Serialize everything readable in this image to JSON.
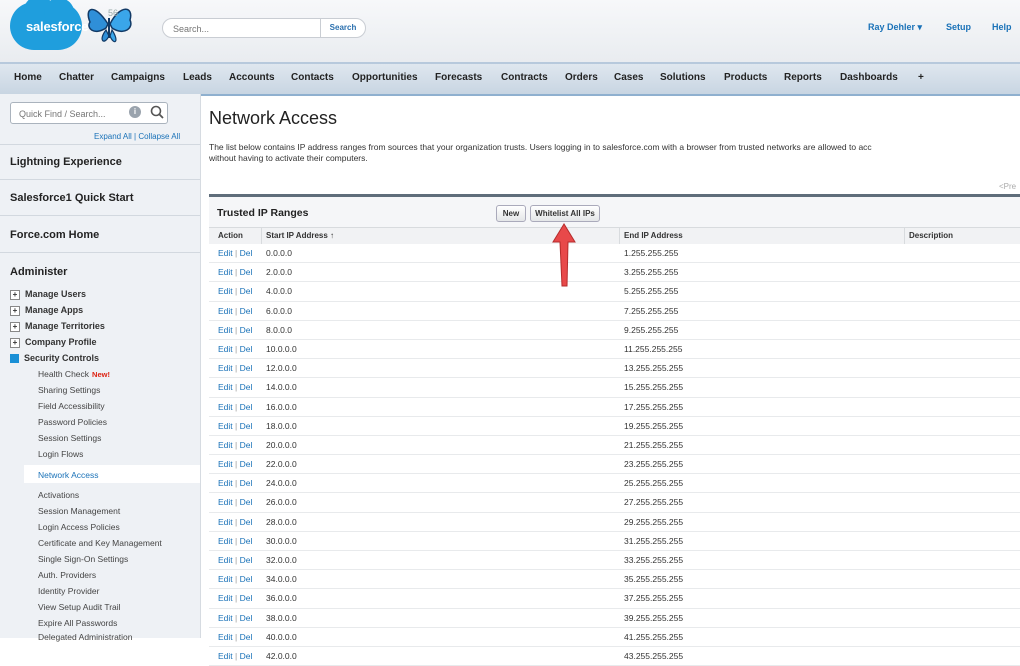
{
  "header": {
    "logo_text": "salesforce",
    "version_badge": "56",
    "search_placeholder": "Search...",
    "search_button": "Search",
    "user_name": "Ray Dehler",
    "setup_label": "Setup",
    "help_label": "Help"
  },
  "nav": {
    "tabs": [
      "Home",
      "Chatter",
      "Campaigns",
      "Leads",
      "Accounts",
      "Contacts",
      "Opportunities",
      "Forecasts",
      "Contracts",
      "Orders",
      "Cases",
      "Solutions",
      "Products",
      "Reports",
      "Dashboards",
      "+"
    ]
  },
  "sidebar": {
    "quick_find_placeholder": "Quick Find / Search...",
    "expand_all": "Expand All",
    "collapse_all": "Collapse All",
    "sections": [
      "Lightning Experience",
      "Salesforce1 Quick Start",
      "Force.com Home",
      "Administer"
    ],
    "groups": [
      "Manage Users",
      "Manage Apps",
      "Manage Territories",
      "Company Profile",
      "Security Controls"
    ],
    "security_items": [
      "Health Check",
      "Sharing Settings",
      "Field Accessibility",
      "Password Policies",
      "Session Settings",
      "Login Flows",
      "Network Access",
      "Activations",
      "Session Management",
      "Login Access Policies",
      "Certificate and Key Management",
      "Single Sign-On Settings",
      "Auth. Providers",
      "Identity Provider",
      "View Setup Audit Trail",
      "Expire All Passwords",
      "Delegated Administration"
    ],
    "new_badge": "New!"
  },
  "main": {
    "title": "Network Access",
    "description_line1": "The list below contains IP address ranges from sources that your organization trusts. Users logging in to salesforce.com with a browser from trusted networks are allowed to acc",
    "description_line2": "without having to activate their computers.",
    "prev_link": "<Pre",
    "panel_title": "Trusted IP Ranges",
    "new_button": "New",
    "whitelist_button": "Whitelist All IPs",
    "columns": {
      "action": "Action",
      "start": "Start IP Address",
      "sort_indicator": "↑",
      "end": "End IP Address",
      "description": "Description"
    },
    "edit_label": "Edit",
    "del_label": "Del",
    "rows": [
      {
        "start": "0.0.0.0",
        "end": "1.255.255.255"
      },
      {
        "start": "2.0.0.0",
        "end": "3.255.255.255"
      },
      {
        "start": "4.0.0.0",
        "end": "5.255.255.255"
      },
      {
        "start": "6.0.0.0",
        "end": "7.255.255.255"
      },
      {
        "start": "8.0.0.0",
        "end": "9.255.255.255"
      },
      {
        "start": "10.0.0.0",
        "end": "11.255.255.255"
      },
      {
        "start": "12.0.0.0",
        "end": "13.255.255.255"
      },
      {
        "start": "14.0.0.0",
        "end": "15.255.255.255"
      },
      {
        "start": "16.0.0.0",
        "end": "17.255.255.255"
      },
      {
        "start": "18.0.0.0",
        "end": "19.255.255.255"
      },
      {
        "start": "20.0.0.0",
        "end": "21.255.255.255"
      },
      {
        "start": "22.0.0.0",
        "end": "23.255.255.255"
      },
      {
        "start": "24.0.0.0",
        "end": "25.255.255.255"
      },
      {
        "start": "26.0.0.0",
        "end": "27.255.255.255"
      },
      {
        "start": "28.0.0.0",
        "end": "29.255.255.255"
      },
      {
        "start": "30.0.0.0",
        "end": "31.255.255.255"
      },
      {
        "start": "32.0.0.0",
        "end": "33.255.255.255"
      },
      {
        "start": "34.0.0.0",
        "end": "35.255.255.255"
      },
      {
        "start": "36.0.0.0",
        "end": "37.255.255.255"
      },
      {
        "start": "38.0.0.0",
        "end": "39.255.255.255"
      },
      {
        "start": "40.0.0.0",
        "end": "41.255.255.255"
      },
      {
        "start": "42.0.0.0",
        "end": "43.255.255.255"
      }
    ]
  },
  "colors": {
    "brand": "#1f9edd",
    "link": "#1a72b8",
    "arrow": "#e8494a"
  }
}
